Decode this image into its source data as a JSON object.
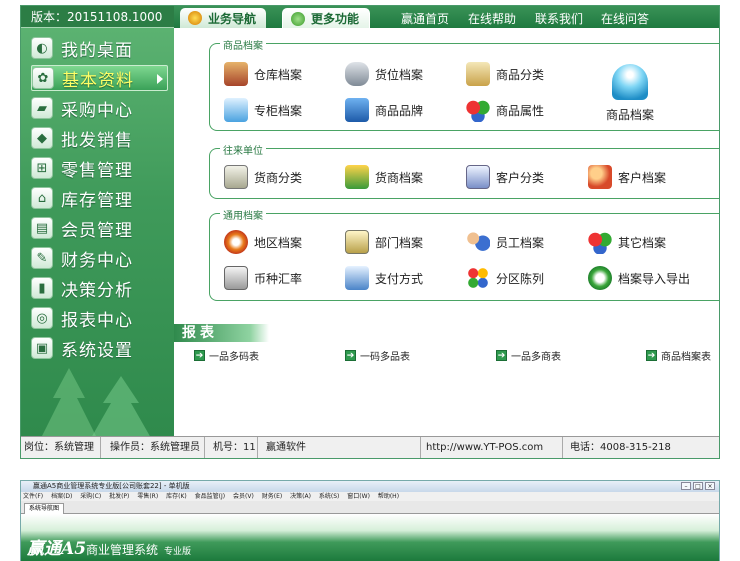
{
  "version": "版本：20151108.1000",
  "nav": [
    {
      "label": "我的桌面",
      "icon": "desktop-icon"
    },
    {
      "label": "基本资料",
      "icon": "basic-data-icon"
    },
    {
      "label": "采购中心",
      "icon": "truck-icon"
    },
    {
      "label": "批发销售",
      "icon": "wholesale-icon"
    },
    {
      "label": "零售管理",
      "icon": "cart-icon"
    },
    {
      "label": "库存管理",
      "icon": "warehouse-icon"
    },
    {
      "label": "会员管理",
      "icon": "member-card-icon"
    },
    {
      "label": "财务中心",
      "icon": "finance-icon"
    },
    {
      "label": "决策分析",
      "icon": "chart-icon"
    },
    {
      "label": "报表中心",
      "icon": "report-icon"
    },
    {
      "label": "系统设置",
      "icon": "settings-icon"
    }
  ],
  "top_tabs": {
    "business": "业务导航",
    "more": "更多功能"
  },
  "top_links": [
    "赢通首页",
    "在线帮助",
    "联系我们",
    "在线问答"
  ],
  "groups": {
    "goods": {
      "title": "商品档案",
      "items": [
        "仓库档案",
        "货位档案",
        "商品分类",
        "专柜档案",
        "商品品牌",
        "商品属性"
      ],
      "big": "商品档案"
    },
    "partners": {
      "title": "往来单位",
      "items": [
        "货商分类",
        "货商档案",
        "客户分类",
        "客户档案"
      ]
    },
    "general": {
      "title": "通用档案",
      "items": [
        "地区档案",
        "部门档案",
        "员工档案",
        "其它档案",
        "币种汇率",
        "支付方式",
        "分区陈列",
        "档案导入导出"
      ]
    }
  },
  "report": {
    "title": "报表",
    "links": [
      "一品多码表",
      "一码多品表",
      "一品多商表",
      "商品档案表"
    ]
  },
  "status": {
    "post": "岗位：系统管理员",
    "operator": "操作员：系统管理员",
    "machine": "机号：11",
    "company": "赢通软件",
    "url": "http://www.YT-POS.com",
    "phone": "电话：4008-315-218"
  },
  "win2": {
    "title": "赢通A5商业管理系统专业版[公司账套22] - 单机版",
    "menu": [
      "文件(F)",
      "档案(D)",
      "采购(C)",
      "批发(P)",
      "零售(R)",
      "库存(K)",
      "食品监管(J)",
      "会员(V)",
      "财务(E)",
      "决策(A)",
      "系统(S)",
      "窗口(W)",
      "帮助(H)"
    ],
    "tab": "系统导航图",
    "logo_main": "赢通A5",
    "logo_sub": "商业管理系统",
    "logo_edition": "专业版"
  },
  "colors": {
    "primary_green": "#3f9a5a",
    "accent_yellow": "#ffff66"
  }
}
